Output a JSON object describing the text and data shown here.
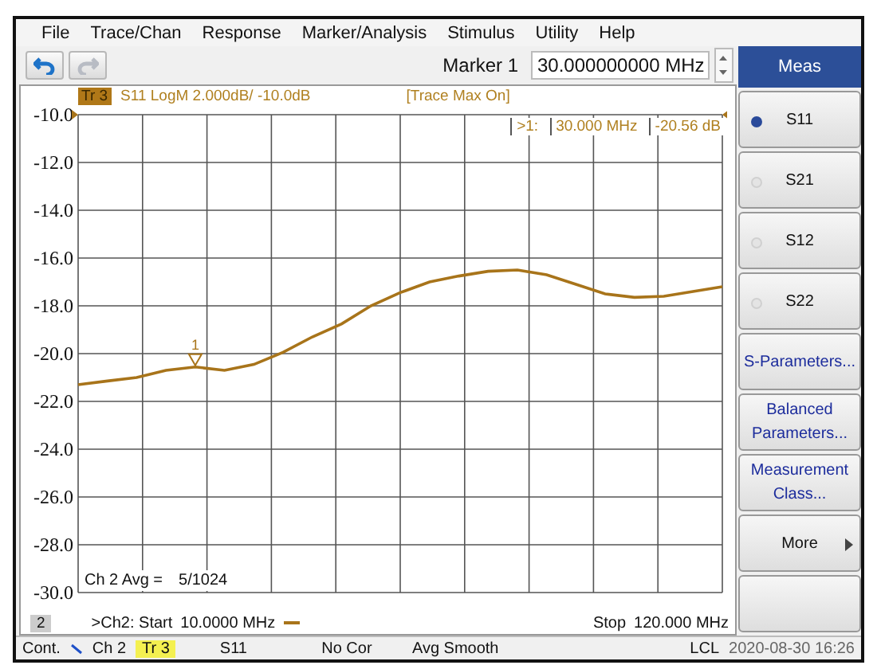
{
  "menu": [
    "File",
    "Trace/Chan",
    "Response",
    "Marker/Analysis",
    "Stimulus",
    "Utility",
    "Help"
  ],
  "toolbar": {
    "undo_disabled": false,
    "redo_disabled": true,
    "marker_label": "Marker 1",
    "marker_value": "30.000000000 MHz"
  },
  "trace_header": {
    "format": "S11 LogM 2.000dB/ -10.0dB",
    "status": "[Trace Max On]"
  },
  "marker_readout": {
    "marker": ">1:",
    "frequency": "30.000 MHz",
    "value": "-20.56 dB"
  },
  "chart_data": {
    "type": "line",
    "categories": [
      null,
      null,
      null,
      null,
      null,
      null,
      null,
      null,
      null,
      null,
      null,
      null,
      null,
      null,
      null,
      null,
      null,
      null,
      null,
      null,
      null,
      null,
      null
    ],
    "series": [
      {
        "name": "Tr 3",
        "color": "#a8741a",
        "values": [
          -21.3,
          -21.15,
          -21.0,
          -20.7,
          -20.56,
          -20.7,
          -20.45,
          -19.95,
          -19.3,
          -18.75,
          -18.0,
          -17.45,
          -17.0,
          -16.75,
          -16.55,
          -16.5,
          -16.7,
          -17.1,
          -17.5,
          -17.65,
          -17.6,
          -17.4,
          -17.2
        ]
      }
    ],
    "ylim": [
      -30,
      -10
    ],
    "yticks": [
      {
        "value": -10,
        "label": "-10.0"
      },
      {
        "value": -12,
        "label": "-12.0"
      },
      {
        "value": -14,
        "label": "-14.0"
      },
      {
        "value": -16,
        "label": "-16.0"
      },
      {
        "value": -18,
        "label": "-18.0"
      },
      {
        "value": -20,
        "label": "-20.0"
      },
      {
        "value": -22,
        "label": "-22.0"
      },
      {
        "value": -24,
        "label": "-24.0"
      },
      {
        "value": -26,
        "label": "-26.0"
      },
      {
        "value": -28,
        "label": "-28.0"
      },
      {
        "value": -30,
        "label": "-30.0"
      }
    ],
    "grid": true,
    "annotations": [
      {
        "y": -20.56,
        "text": "1"
      }
    ]
  },
  "average": {
    "label": "Ch 2 Avg =",
    "value": "5/1024"
  },
  "channel": {
    "number": "2",
    "start_label": ">Ch2:  Start",
    "start": "10.0000 MHz",
    "stop_label": "Stop",
    "stop": "120.000 MHz"
  },
  "softkeys": {
    "title": "Meas",
    "items": [
      {
        "kind": "radio",
        "label": "S11",
        "selected": true
      },
      {
        "kind": "radio",
        "label": "S21",
        "selected": false
      },
      {
        "kind": "radio",
        "label": "S12",
        "selected": false
      },
      {
        "kind": "radio",
        "label": "S22",
        "selected": false
      },
      {
        "kind": "button",
        "label": "S-Parameters..."
      },
      {
        "kind": "button",
        "label": "Balanced Parameters..."
      },
      {
        "kind": "button",
        "label": "Measurement Class..."
      },
      {
        "kind": "submenu",
        "label": "More"
      },
      {
        "kind": "blank"
      }
    ]
  },
  "status_bar": {
    "mode": "Cont.",
    "channel": "Ch 2",
    "trace": "Tr 3",
    "parameter": "S11",
    "correction": "No Cor",
    "smoothing": "Avg Smooth",
    "control": "LCL",
    "datetime": "2020-08-30 16:26"
  }
}
